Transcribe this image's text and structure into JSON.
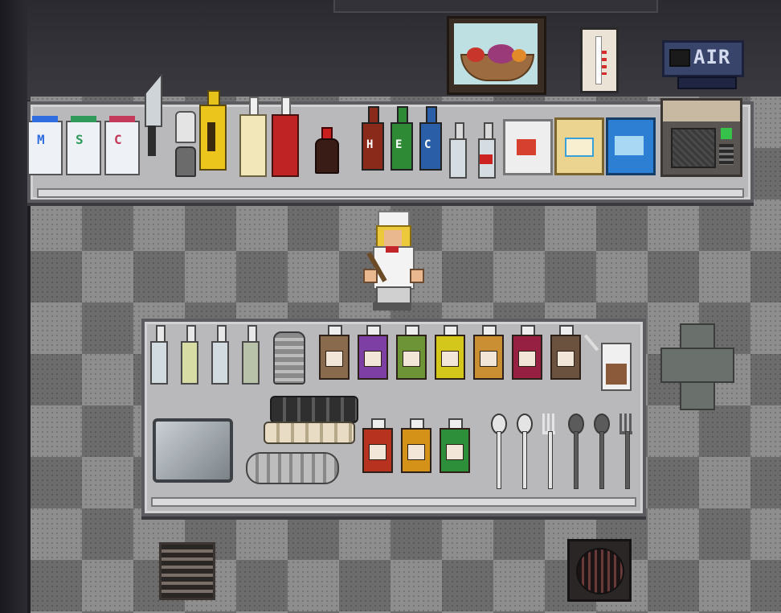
{
  "hud": {
    "air_label": "AIR"
  },
  "shaker_labels": [
    "M",
    "S",
    "C"
  ],
  "sauce_labels": [
    "H",
    "E",
    "C"
  ],
  "colors": {
    "floor_light": "#8e8e8e",
    "floor_dark": "#6c6c6c",
    "counter_top": "#b9b9bb",
    "counter_border": "#5c5c60",
    "wall": "#2b2a30",
    "hud_panel": "#39446a"
  },
  "jugs_top": [
    {
      "name": "brown",
      "color": "#8a6a4d",
      "icon": "bag"
    },
    {
      "name": "purple",
      "color": "#7d3fa3",
      "icon": "grape"
    },
    {
      "name": "green",
      "color": "#6d9436",
      "icon": "watermelon"
    },
    {
      "name": "yellow",
      "color": "#d4c71c",
      "icon": "banana"
    },
    {
      "name": "orange",
      "color": "#c98f32",
      "icon": "carrot"
    },
    {
      "name": "crimson",
      "color": "#962041",
      "icon": "berry"
    },
    {
      "name": "dark-brown",
      "color": "#6a523e",
      "icon": "box"
    }
  ],
  "jugs_bottom": [
    {
      "name": "tomato",
      "color": "#b8331f",
      "icon": "tomato"
    },
    {
      "name": "orange-juice",
      "color": "#d49318",
      "icon": "orange"
    },
    {
      "name": "lime",
      "color": "#2e8f3a",
      "icon": "lime"
    }
  ],
  "bottles_small": [
    "#d2dbe0",
    "#d6dca4",
    "#d2dbe0",
    "#b8c2a8"
  ]
}
